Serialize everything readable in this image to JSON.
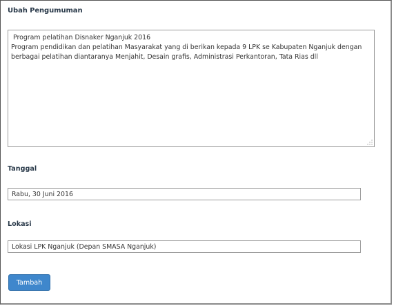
{
  "form": {
    "title": "Ubah Pengumuman",
    "announcement_text": " Program pelatihan Disnaker Nganjuk 2016\nProgram pendidikan dan pelatihan Masyarakat yang di berikan kepada 9 LPK se Kabupaten Nganjuk dengan berbagai pelatihan diantaranya Menjahit, Desain grafis, Administrasi Perkantoran, Tata Rias dll",
    "date_label": "Tanggal",
    "date_value": "Rabu, 30 Juni 2016",
    "location_label": "Lokasi",
    "location_value": "Lokasi LPK Nganjuk (Depan SMASA Nganjuk)",
    "submit_label": "Tambah"
  },
  "colors": {
    "button_background": "#3f87cc",
    "label_text": "#2a3a4a",
    "field_border": "#9a9a9a"
  },
  "icons": {
    "textarea_resize": "resize-grip-icon"
  }
}
